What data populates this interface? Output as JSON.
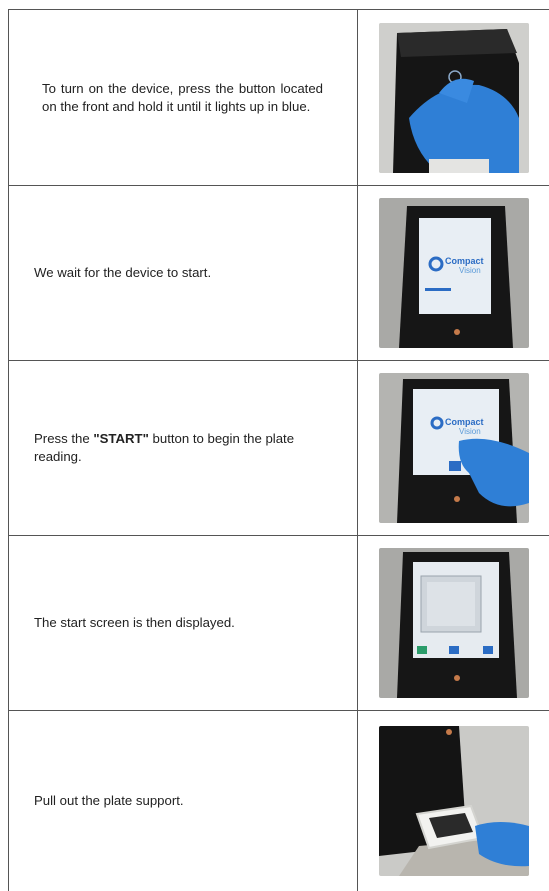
{
  "steps": [
    {
      "text": "To turn on the device, press the button located on the front and hold it until it lights up in blue.",
      "photo": "device-power-button-photo"
    },
    {
      "text": "We wait for the device to start.",
      "photo": "device-starting-photo"
    },
    {
      "text_before": "Press the ",
      "text_bold": "\"START\"",
      "text_after": " button to begin the plate reading.",
      "photo": "start-button-photo"
    },
    {
      "text": "The start screen is then displayed.",
      "photo": "start-screen-photo"
    },
    {
      "text": "Pull out the plate support.",
      "photo": "plate-support-photo"
    }
  ],
  "screen_logo": {
    "line1": "Compact",
    "line2": "Vision"
  },
  "colors": {
    "border": "#555555",
    "glove": "#2f7fd6",
    "device": "#1a1a1a",
    "brand": "#2b6cc4"
  }
}
